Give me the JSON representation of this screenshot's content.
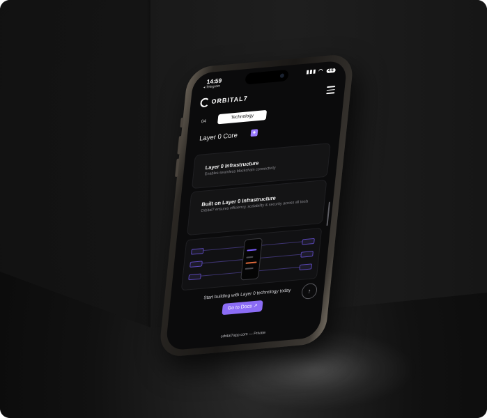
{
  "scene": {
    "background_color": "#0f0f0f",
    "accent_color": "#8b6cf5"
  },
  "status_bar": {
    "time": "14:59",
    "back_app": "◂ Telegram",
    "battery": "46"
  },
  "nav": {
    "logo": "ORBITAL7"
  },
  "section": {
    "number": "04",
    "tag": "Technology",
    "title": "Layer 0 Core"
  },
  "cards": [
    {
      "title": "Layer 0 Infrastructure",
      "subtitle": "Enables seamless blockchain connectivity"
    },
    {
      "title": "Built on Layer 0 Infrastructure",
      "subtitle": "Orbital7 ensures efficiency, scalability & security across all tools"
    }
  ],
  "cta": {
    "text": "Start building with Layer 0 technology today",
    "button": "Go to Docs ↗"
  },
  "footer": {
    "url": "orbital7app.com — Private"
  }
}
